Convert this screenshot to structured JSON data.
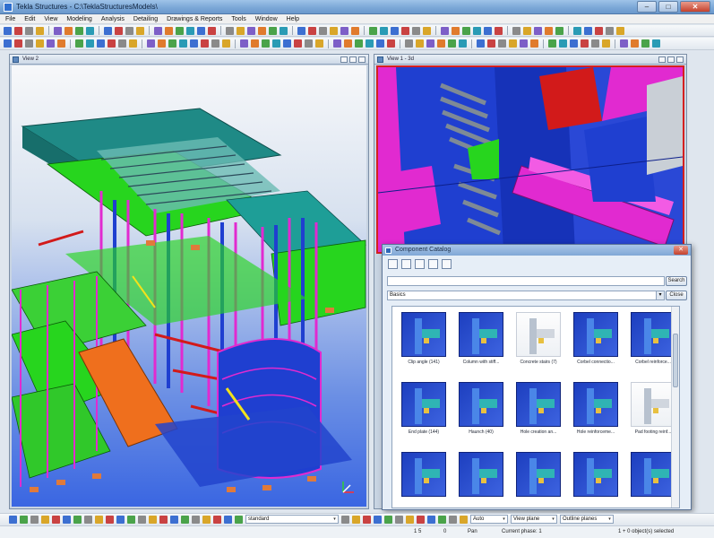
{
  "window": {
    "title": "Tekla Structures - C:\\TeklaStructuresModels\\"
  },
  "menu": [
    "File",
    "Edit",
    "View",
    "Modeling",
    "Analysis",
    "Detailing",
    "Drawings & Reports",
    "Tools",
    "Window",
    "Help"
  ],
  "views": {
    "left": {
      "title": "View 2"
    },
    "right": {
      "title": "View 1 - 3d"
    }
  },
  "catalog": {
    "title": "Component Catalog",
    "search_value": "",
    "search_button": "Search",
    "filter_value": "Basics",
    "close_button": "Close",
    "items": [
      {
        "label": "Clip angle (141)"
      },
      {
        "label": "Column with stiff..."
      },
      {
        "label": "Concrete stairs (7)"
      },
      {
        "label": "Corbel connectio..."
      },
      {
        "label": "Corbel reinforce..."
      },
      {
        "label": "End plate (144)"
      },
      {
        "label": "Haunch (40)"
      },
      {
        "label": "Hole creation an..."
      },
      {
        "label": "Hole reinforceme..."
      },
      {
        "label": "Pad footing reinf..."
      },
      {
        "label": ""
      },
      {
        "label": ""
      },
      {
        "label": ""
      },
      {
        "label": ""
      },
      {
        "label": ""
      }
    ]
  },
  "bottom_toolbar": {
    "standard_value": "standard",
    "auto_value": "Auto",
    "view_planes_value": "View plane",
    "outline_planes_value": "Outline planes"
  },
  "status": {
    "coord": "1 5",
    "zero": "0",
    "mode": "Pan",
    "phase": "Current phase: 1",
    "selection": "1 + 0 object(s) selected"
  },
  "colors": {
    "titlebar": "#7aa6d6",
    "model_green": "#27d51e",
    "model_magenta": "#e12ad0",
    "model_blue": "#1f3fd0",
    "model_orange": "#ef6f1d",
    "model_teal": "#1f8a86",
    "selection_border": "#d42020"
  }
}
